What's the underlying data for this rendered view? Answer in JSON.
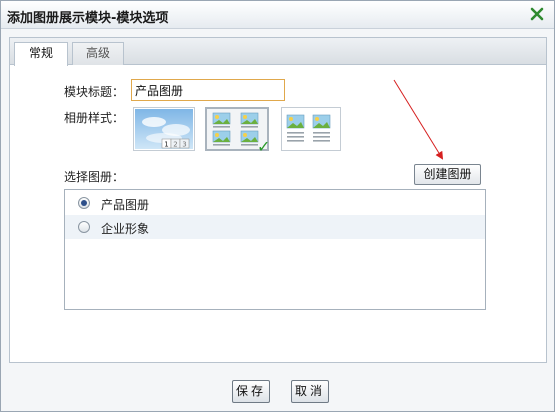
{
  "dialog": {
    "title": "添加图册展示模块-模块选项"
  },
  "tabs": [
    {
      "label": "常规",
      "active": true
    },
    {
      "label": "高级",
      "active": false
    }
  ],
  "form": {
    "module_title_label": "模块标题：",
    "module_title_value": "产品图册",
    "album_style_label": "相册样式：",
    "album_style_options": [
      "slideshow-style",
      "grid-style",
      "row-style"
    ],
    "album_style_selected_index": 1,
    "slideshow_pages": [
      "1",
      "2",
      "3"
    ],
    "select_album_label": "选择图册：",
    "create_album_button": "创建图册"
  },
  "albums": [
    {
      "name": "产品图册",
      "selected": true
    },
    {
      "name": "企业形象",
      "selected": false
    }
  ],
  "footer": {
    "save_label": "保存",
    "cancel_label": "取消"
  },
  "colors": {
    "close_icon": "#2f8a2f",
    "input_border": "#e0a84c",
    "arrow": "#d62020",
    "check": "#2a9a2a"
  }
}
